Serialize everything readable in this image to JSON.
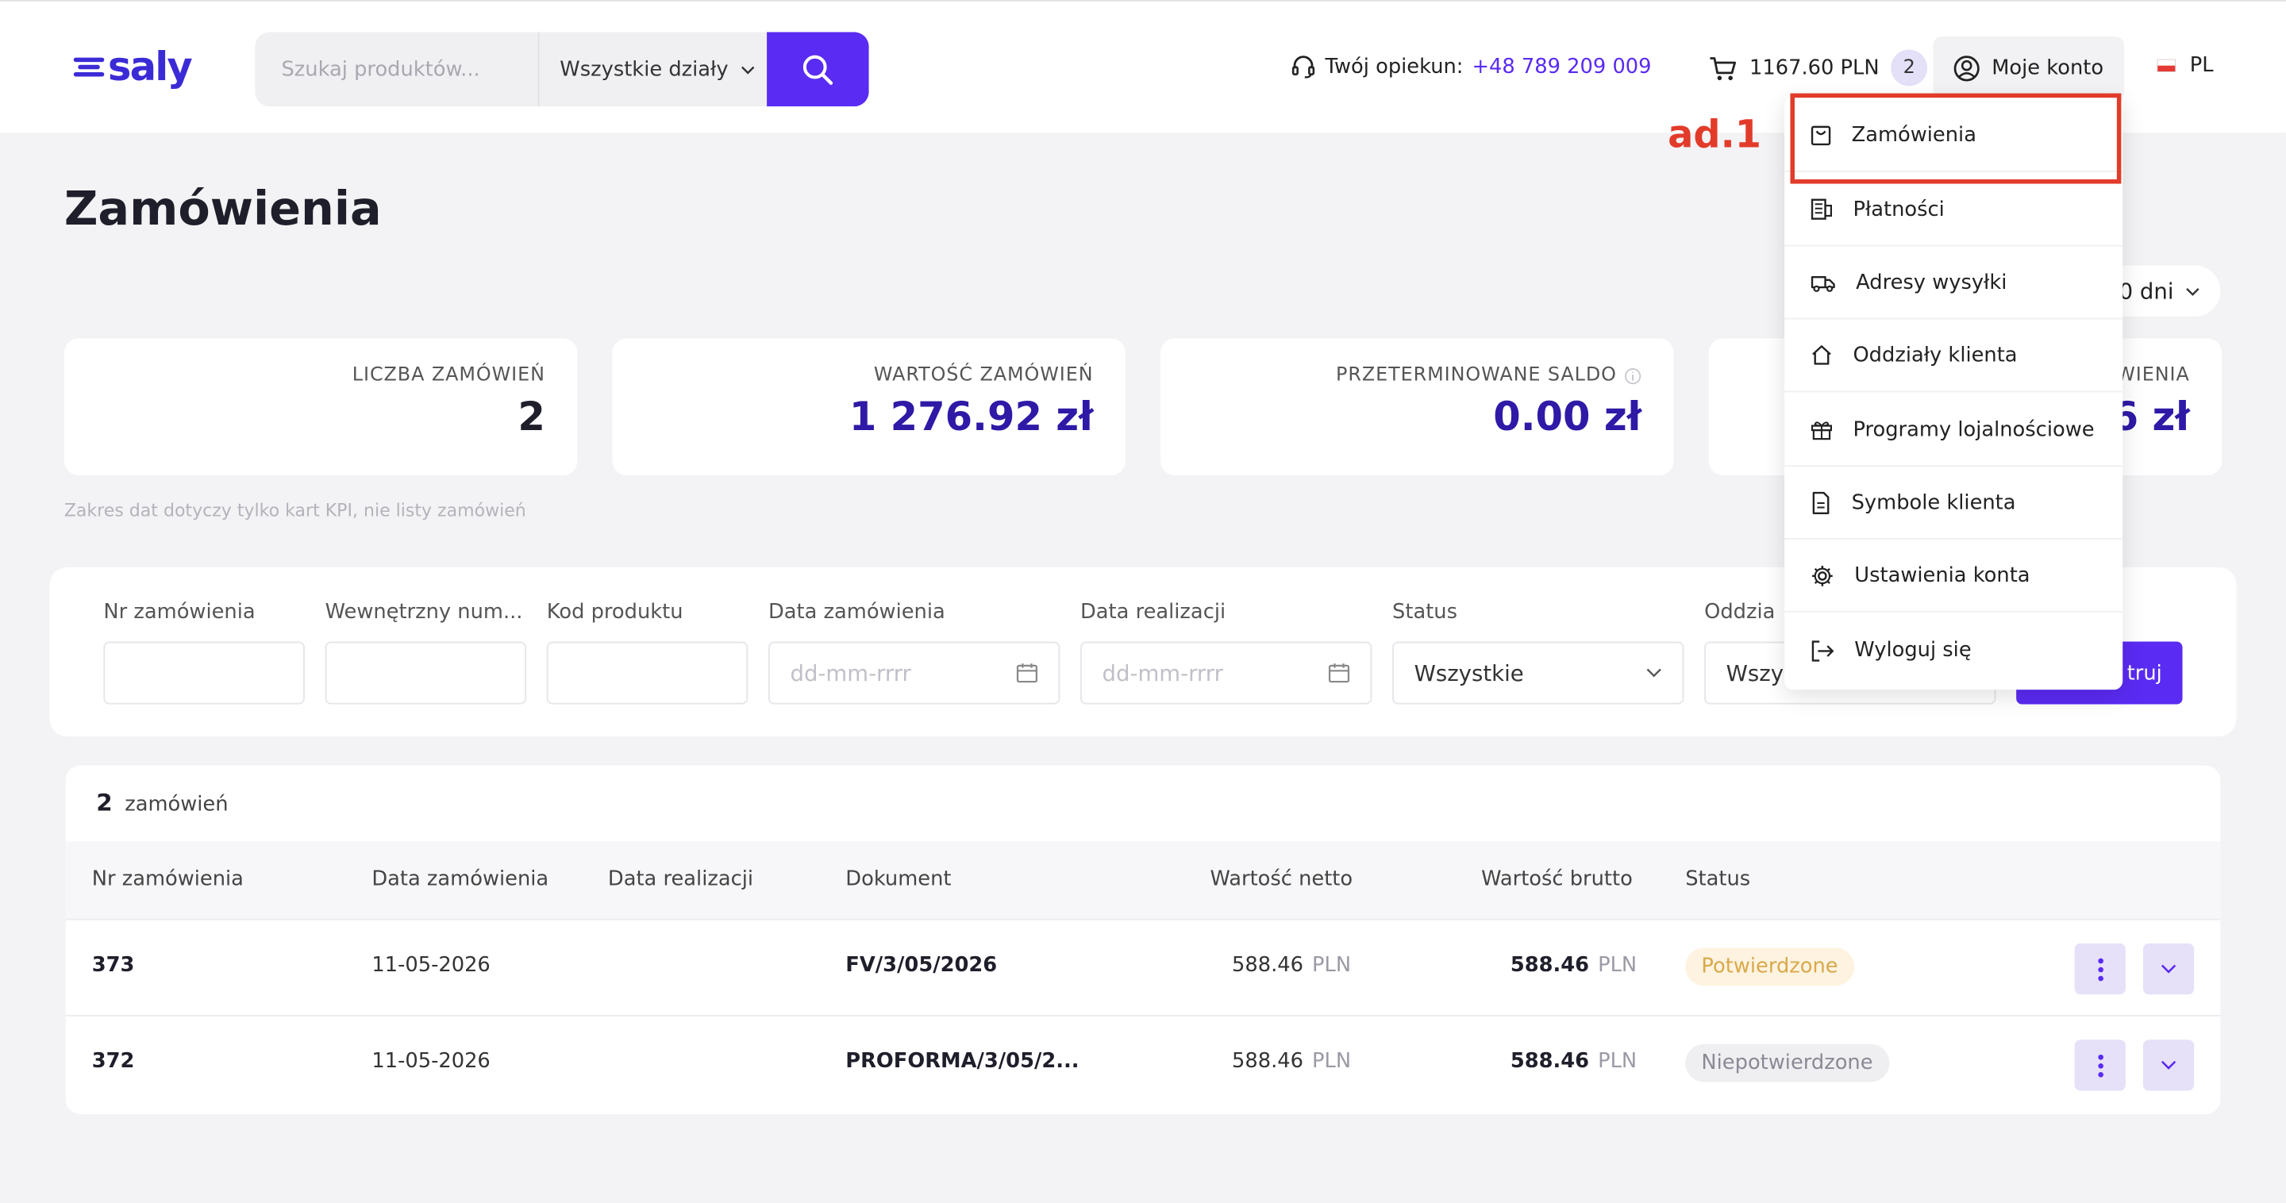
{
  "header": {
    "logo_text": "saly",
    "search_placeholder": "Szukaj produktów...",
    "department": "Wszystkie działy",
    "support_label": "Twój opiekun:",
    "support_phone": "+48 789 209 009",
    "cart_total": "1167.60 PLN",
    "cart_count": "2",
    "account_label": "Moje konto",
    "language": "PL"
  },
  "page": {
    "title": "Zamówienia",
    "period_label": "0 dni",
    "kpi_note": "Zakres dat dotyczy tylko kart KPI, nie listy zamówień"
  },
  "kpis": [
    {
      "label": "LICZBA ZAMÓWIEŃ",
      "value": "2"
    },
    {
      "label": "WARTOŚĆ ZAMÓWIEŃ",
      "value": "1 276.92 zł"
    },
    {
      "label": "PRZETERMINOWANE SALDO",
      "value": "0.00 zł"
    },
    {
      "label": "WIENIA",
      "value": "6 zł"
    }
  ],
  "filters": {
    "order_no_label": "Nr zamówienia",
    "internal_no_label": "Wewnętrzny num...",
    "product_code_label": "Kod produktu",
    "order_date_label": "Data zamówienia",
    "order_date_placeholder": "dd-mm-rrrr",
    "realization_date_label": "Data realizacji",
    "realization_date_placeholder": "dd-mm-rrrr",
    "status_label": "Status",
    "status_value": "Wszystkie",
    "branch_label": "Oddzia",
    "branch_value": "Wszy",
    "filter_button": "truj"
  },
  "orders": {
    "count": "2",
    "count_label": "zamówień",
    "columns": [
      "Nr zamówienia",
      "Data zamówienia",
      "Data realizacji",
      "Dokument",
      "Wartość netto",
      "Wartość brutto",
      "Status"
    ],
    "rows": [
      {
        "nr": "373",
        "date": "11-05-2026",
        "realization": "",
        "document": "FV/3/05/2026",
        "net": "588.46",
        "gross": "588.46",
        "currency": "PLN",
        "status": "Potwierdzone"
      },
      {
        "nr": "372",
        "date": "11-05-2026",
        "realization": "",
        "document": "PROFORMA/3/05/2...",
        "net": "588.46",
        "gross": "588.46",
        "currency": "PLN",
        "status": "Niepotwierdzone"
      }
    ]
  },
  "account_menu": {
    "items": [
      {
        "label": "Zamówienia",
        "icon": "orders-icon"
      },
      {
        "label": "Płatności",
        "icon": "payments-icon"
      },
      {
        "label": "Adresy wysyłki",
        "icon": "truck-icon"
      },
      {
        "label": "Oddziały klienta",
        "icon": "home-icon"
      },
      {
        "label": "Programy lojalnościowe",
        "icon": "gift-icon"
      },
      {
        "label": "Symbole klienta",
        "icon": "document-icon"
      },
      {
        "label": "Ustawienia konta",
        "icon": "gear-icon"
      },
      {
        "label": "Wyloguj się",
        "icon": "logout-icon"
      }
    ]
  },
  "annotation": {
    "text": "ad.1",
    "color": "#e23b2a"
  },
  "colors": {
    "accent": "#5a2bf2",
    "kpi_value": "#2e1aa6"
  }
}
